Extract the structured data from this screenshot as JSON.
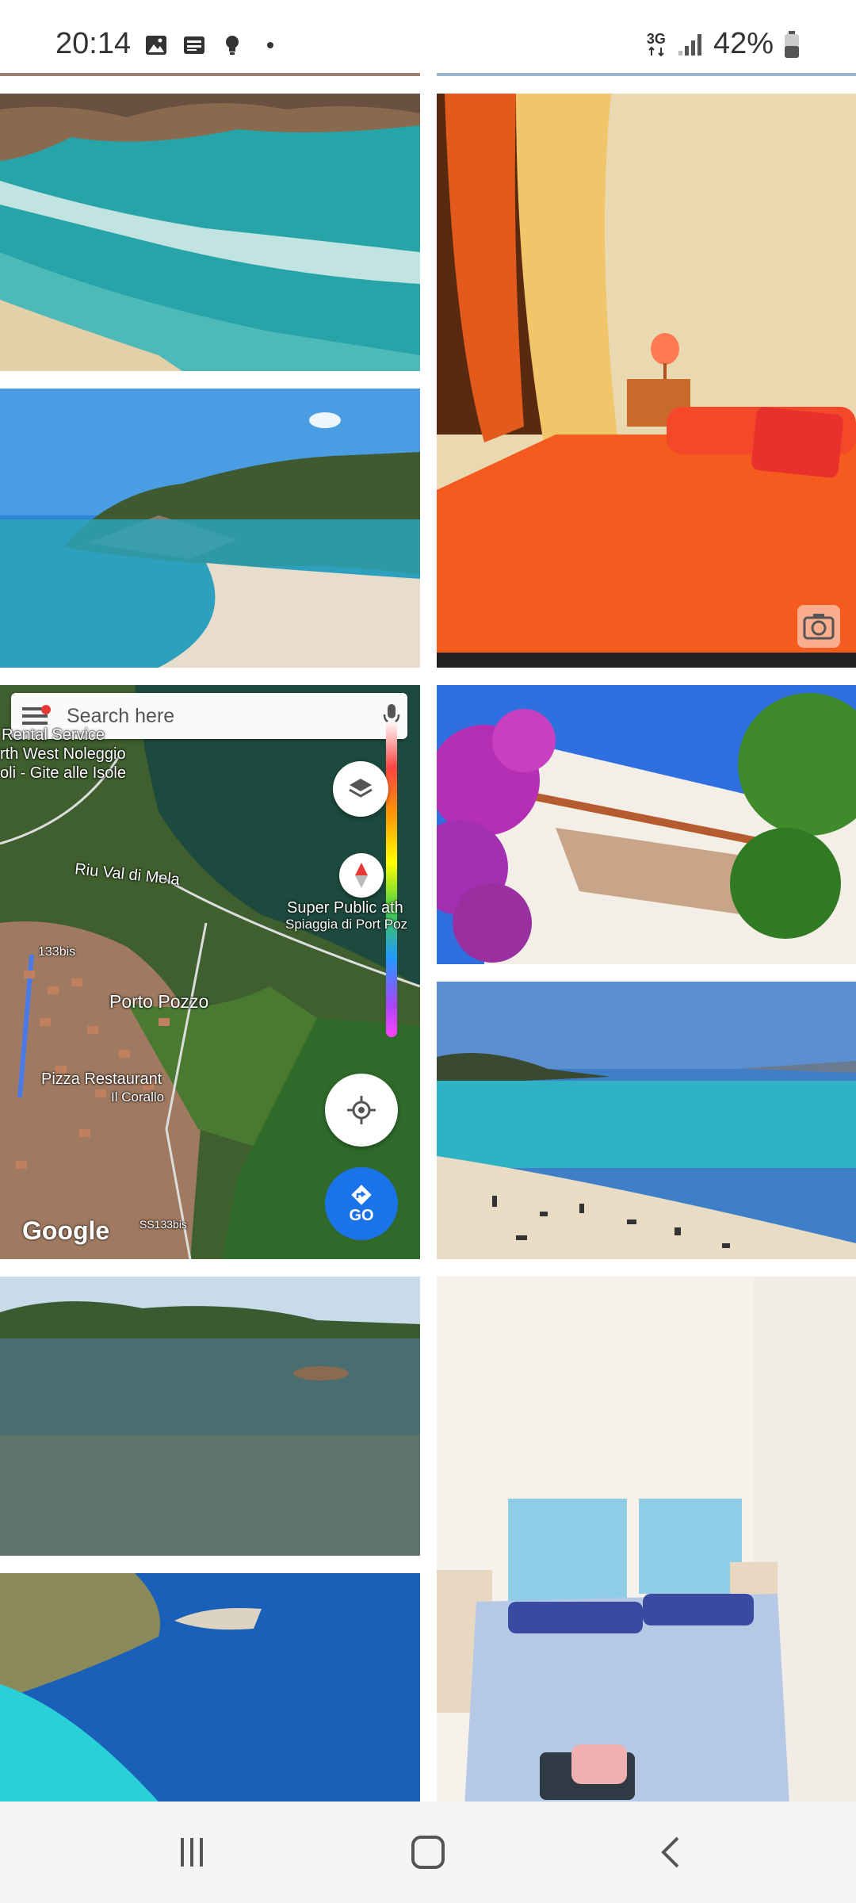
{
  "status_bar": {
    "time": "20:14",
    "network_label": "3G",
    "battery": "42%",
    "left_icons": [
      "gallery-icon",
      "news-icon",
      "bulb-icon",
      "dot-icon"
    ],
    "right_icons": [
      "network-3g-icon",
      "signal-icon",
      "battery-icon"
    ]
  },
  "gallery": {
    "photos": [
      {
        "name": "beach-waves",
        "description": "rocky beach with turquoise waves"
      },
      {
        "name": "red-bedroom",
        "description": "bedroom with orange bed and curtains"
      },
      {
        "name": "bay-headland",
        "description": "sandy bay with green headland"
      },
      {
        "name": "map-screenshot",
        "description": "Google Maps satellite screenshot"
      },
      {
        "name": "bougainvillea-roof",
        "description": "purple bougainvillea on roof"
      },
      {
        "name": "sandy-beach-people",
        "description": "beach with sunbathers"
      },
      {
        "name": "clear-sea-hills",
        "description": "clear sea with hills"
      },
      {
        "name": "blue-bedroom",
        "description": "bedroom with blue patterned bedding"
      },
      {
        "name": "aerial-coast",
        "description": "aerial view of turquoise coast"
      }
    ]
  },
  "map": {
    "search_placeholder": "Search here",
    "labels": {
      "rental": "Rental Service",
      "north_west": "rth West Noleggio",
      "gite": "oli - Gite alle Isole",
      "river": "Riu Val di Mela",
      "super_public": "Super Public ath",
      "spiaggia": "Spiaggia di Port Poz",
      "road1": "133bis",
      "town": "Porto Pozzo",
      "pizza": "Pizza Restaurant",
      "corallo": "Il Corallo",
      "road2": "SS133bis",
      "google": "Google",
      "go": "GO"
    }
  },
  "nav_bar": {
    "buttons": [
      "recent-apps-icon",
      "home-icon",
      "back-icon"
    ]
  },
  "colors": {
    "nav_background": "#f5f5f5",
    "go_button": "#1a73e8",
    "sea": "#2bb0b8"
  }
}
